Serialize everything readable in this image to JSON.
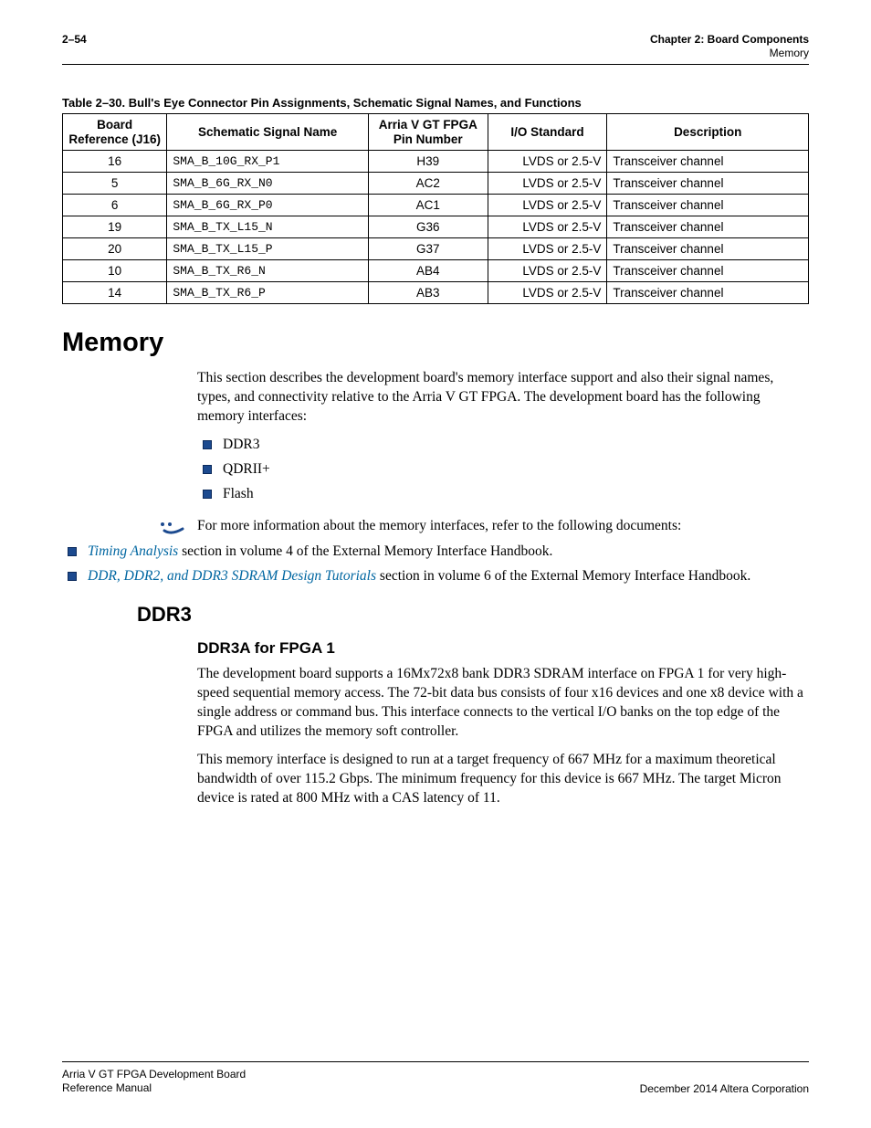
{
  "header": {
    "page_num": "2–54",
    "chapter": "Chapter 2: Board Components",
    "section": "Memory"
  },
  "table": {
    "caption": "Table 2–30. Bull's Eye Connector Pin Assignments, Schematic Signal Names, and Functions",
    "headers": {
      "c1a": "Board",
      "c1b": "Reference (J16)",
      "c2": "Schematic Signal Name",
      "c3a": "Arria V GT FPGA",
      "c3b": "Pin Number",
      "c4": "I/O Standard",
      "c5": "Description"
    },
    "rows": [
      {
        "ref": "16",
        "sig": "SMA_B_10G_RX_P1",
        "pin": "H39",
        "io": "LVDS or 2.5-V",
        "desc": "Transceiver channel"
      },
      {
        "ref": "5",
        "sig": "SMA_B_6G_RX_N0",
        "pin": "AC2",
        "io": "LVDS or 2.5-V",
        "desc": "Transceiver channel"
      },
      {
        "ref": "6",
        "sig": "SMA_B_6G_RX_P0",
        "pin": "AC1",
        "io": "LVDS or 2.5-V",
        "desc": "Transceiver channel"
      },
      {
        "ref": "19",
        "sig": "SMA_B_TX_L15_N",
        "pin": "G36",
        "io": "LVDS or 2.5-V",
        "desc": "Transceiver channel"
      },
      {
        "ref": "20",
        "sig": "SMA_B_TX_L15_P",
        "pin": "G37",
        "io": "LVDS or 2.5-V",
        "desc": "Transceiver channel"
      },
      {
        "ref": "10",
        "sig": "SMA_B_TX_R6_N",
        "pin": "AB4",
        "io": "LVDS or 2.5-V",
        "desc": "Transceiver channel"
      },
      {
        "ref": "14",
        "sig": "SMA_B_TX_R6_P",
        "pin": "AB3",
        "io": "LVDS or 2.5-V",
        "desc": "Transceiver channel"
      }
    ]
  },
  "memory": {
    "title": "Memory",
    "intro": "This section describes the development board's memory interface support and also their signal names, types, and connectivity relative to the Arria V GT FPGA. The development board has the following memory interfaces:",
    "bullets": [
      "DDR3",
      "QDRII+",
      "Flash"
    ],
    "note": "For more information about the memory interfaces, refer to the following documents:",
    "docs": [
      {
        "link": "Timing Analysis",
        "rest": " section in volume 4 of the External Memory Interface Handbook."
      },
      {
        "link": "DDR, DDR2, and DDR3 SDRAM Design Tutorials",
        "rest": " section in volume 6 of the External Memory Interface Handbook."
      }
    ]
  },
  "ddr3": {
    "title": "DDR3",
    "sub": "DDR3A for FPGA 1",
    "p1": "The development board supports a 16Mx72x8 bank DDR3 SDRAM interface on FPGA 1 for very high-speed sequential memory access. The 72-bit data bus consists of four x16 devices and one x8 device with a single address or command bus. This interface connects to the vertical I/O banks on the top edge of the FPGA and utilizes the memory soft controller.",
    "p2": "This memory interface is designed to run at a target frequency of 667 MHz for a maximum theoretical bandwidth of over 115.2 Gbps. The minimum frequency for this device is 667 MHz. The target Micron device is rated at 800 MHz with a CAS latency of 11."
  },
  "footer": {
    "left1": "Arria V GT FPGA Development Board",
    "left2": "Reference Manual",
    "right": "December 2014   Altera Corporation"
  }
}
